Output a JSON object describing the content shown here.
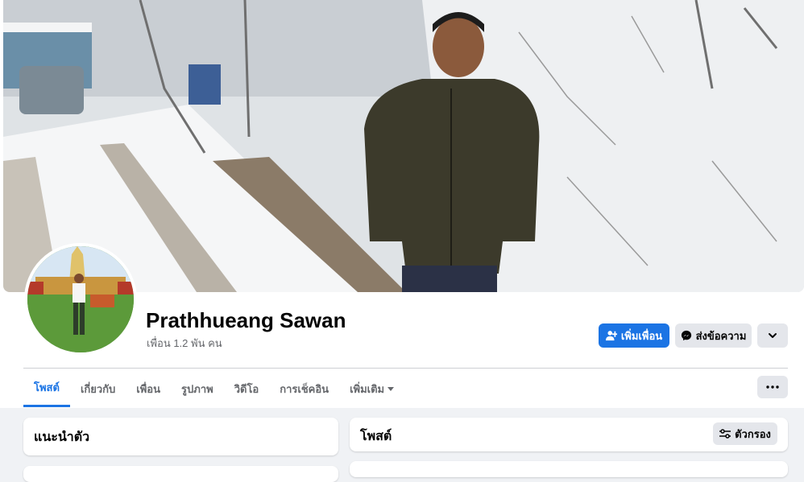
{
  "profile": {
    "name": "Prathhueang Sawan",
    "friends_count": "เพื่อน 1.2 พัน คน"
  },
  "actions": {
    "add_friend": "เพิ่มเพื่อน",
    "message": "ส่งข้อความ"
  },
  "tabs": [
    {
      "label": "โพสต์",
      "active": true
    },
    {
      "label": "เกี่ยวกับ"
    },
    {
      "label": "เพื่อน"
    },
    {
      "label": "รูปภาพ"
    },
    {
      "label": "วิดีโอ"
    },
    {
      "label": "การเช็คอิน"
    },
    {
      "label": "เพิ่มเติม"
    }
  ],
  "intro": {
    "title": "แนะนำตัว"
  },
  "posts": {
    "title": "โพสต์",
    "filter_label": "ตัวกรอง"
  },
  "colors": {
    "accent": "#1b74e4",
    "secondary_button": "#e4e6eb",
    "background": "#f0f2f5"
  },
  "icons": {
    "add_friend": "person-add-icon",
    "message": "messenger-icon",
    "more": "chevron-down-icon",
    "tab_more": "ellipsis-icon",
    "filter": "sliders-icon"
  }
}
